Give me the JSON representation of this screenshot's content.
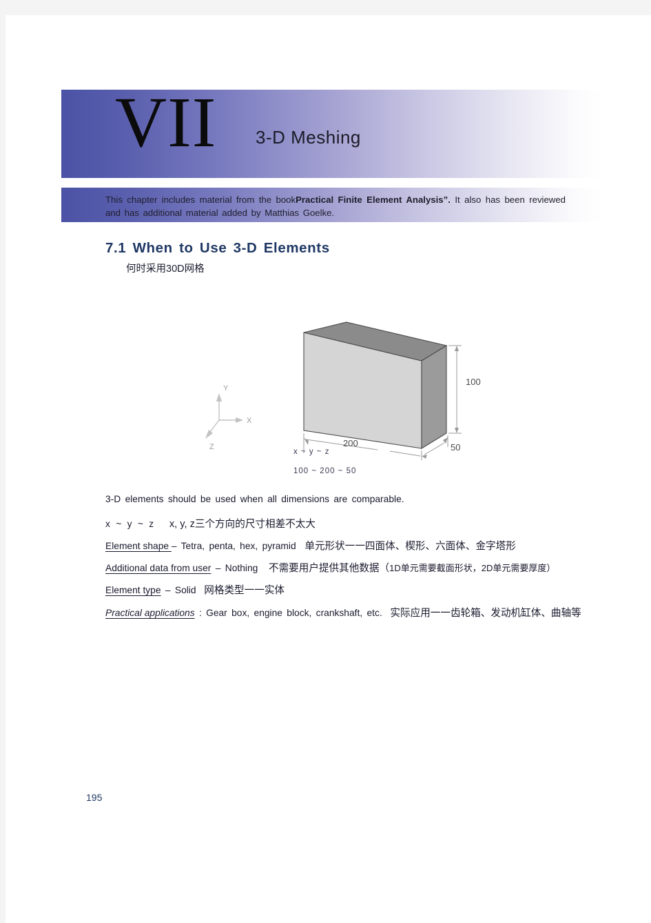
{
  "document": {
    "page_number": "195"
  },
  "chapter": {
    "numeral": "VII",
    "title": "3-D  Meshing",
    "credit_prefix": "This chapter includes material from the book",
    "credit_book": "Practical Finite Element Analysis”.",
    "credit_suffix": " It also has been reviewed and has additional material added by Matthias Goelke."
  },
  "section": {
    "heading": "7.1  When  to  Use  3-D  Elements",
    "heading_cn": "何时采用30D网格"
  },
  "figure": {
    "name": "3d-box-diagram",
    "dim_width": "200",
    "dim_height": "100",
    "dim_depth": "50",
    "ratio_label": "x ~ y ~ z",
    "ratio_values": "100 ~ 200 ~ 50",
    "axis_x": "X",
    "axis_y": "Y",
    "axis_z": "Z",
    "colors": {
      "front_face": "#d5d5d5",
      "top_face": "#8b8b8b",
      "side_face": "#9b9b9b",
      "outline": "#4a4a4a",
      "dimension_line": "#9a9a9a",
      "axis_line": "#c2c2c2",
      "label": "#5a5a5a"
    }
  },
  "body": {
    "line1": "3-D elements should be used when all dimensions are comparable.",
    "line2_eng": "x  ~ y ~  z",
    "line2_cn": "x, y, z三个方向的尺寸相差不太大",
    "line3_term": "Element shape ",
    "line3_eng": "–  Tetra, penta, hex, pyramid",
    "line3_cn": "单元形状一一四面体、楔形、六面体、金字塔形",
    "line4_term": "Additional data from user",
    "line4_eng": " –  Nothing",
    "line4_cn": "不需要用户提供其他数据（",
    "line4_cn_b": "1D单元需要截面形状，",
    "line4_cn_c": "2D单元需要厚度）",
    "line5_term": "Element type",
    "line5_eng": " –  Solid",
    "line5_cn": "网格类型一一实体",
    "line6_term": "Practical applications",
    "line6_eng": " :   Gear box, engine block, crankshaft, etc.",
    "line6_cn": "实际应用一一齿轮箱、发动机缸体、曲轴等"
  },
  "theme": {
    "banner_start": "#4b52a5",
    "banner_end": "#ffffff",
    "heading_color": "#1f3864",
    "page_background": "#ffffff",
    "outer_background": "#f4f4f4"
  }
}
